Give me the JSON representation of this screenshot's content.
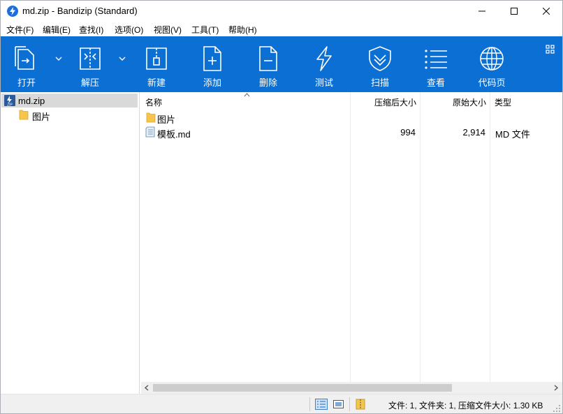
{
  "window": {
    "title": "md.zip - Bandizip (Standard)"
  },
  "menu": [
    "文件(F)",
    "编辑(E)",
    "查找(I)",
    "选项(O)",
    "视图(V)",
    "工具(T)",
    "帮助(H)"
  ],
  "toolbar": [
    {
      "label": "打开",
      "icon": "open-icon"
    },
    {
      "label": "解压",
      "icon": "extract-icon"
    },
    {
      "label": "新建",
      "icon": "new-archive-icon"
    },
    {
      "label": "添加",
      "icon": "add-file-icon"
    },
    {
      "label": "删除",
      "icon": "delete-file-icon"
    },
    {
      "label": "测试",
      "icon": "test-icon"
    },
    {
      "label": "扫描",
      "icon": "scan-shield-icon"
    },
    {
      "label": "查看",
      "icon": "view-list-icon"
    },
    {
      "label": "代码页",
      "icon": "codepage-globe-icon"
    }
  ],
  "tree": {
    "root": "md.zip",
    "children": [
      "图片"
    ]
  },
  "columns": {
    "name": "名称",
    "compressed": "压缩后大小",
    "original": "原始大小",
    "type": "类型"
  },
  "files": [
    {
      "name": "图片",
      "compressed": "",
      "original": "",
      "type": "",
      "kind": "folder"
    },
    {
      "name": "模板.md",
      "compressed": "994",
      "original": "2,914",
      "type": "MD 文件",
      "kind": "file"
    }
  ],
  "status": {
    "text": "文件: 1, 文件夹: 1, 压缩文件大小: 1.30 KB"
  },
  "colors": {
    "toolbar_bg": "#0b6fd4",
    "selection": "#d9d9d9",
    "folder": "#f5c54c"
  }
}
